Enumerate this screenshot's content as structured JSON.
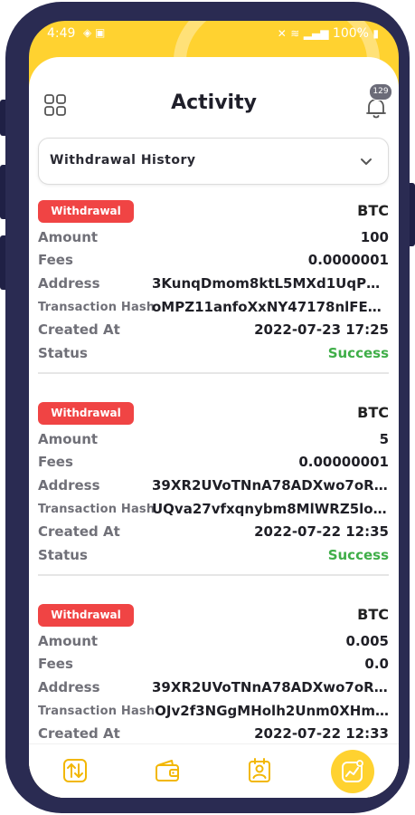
{
  "status_bar": {
    "time": "4:49",
    "battery": "100%"
  },
  "header": {
    "title": "Activity",
    "notification_count": "129"
  },
  "filter": {
    "selected": "Withdrawal History"
  },
  "labels": {
    "amount": "Amount",
    "fees": "Fees",
    "address": "Address",
    "tx_hash": "Transaction Hash",
    "created_at": "Created At",
    "status": "Status"
  },
  "records": [
    {
      "type": "Withdrawal",
      "coin": "BTC",
      "amount": "100",
      "fees": "0.0000001",
      "address": "3KunqDmom8ktL5MXd1UqP1n…",
      "tx_hash": "oMPZ11anfoXxNY47178nlFExOl…",
      "created_at": "2022-07-23 17:25",
      "status": "Success"
    },
    {
      "type": "Withdrawal",
      "coin": "BTC",
      "amount": "5",
      "fees": "0.00000001",
      "address": "39XR2UVoTNnA78ADXwo7oRLf…",
      "tx_hash": "UQva27vfxqnybm8MlWRZ5lo2…",
      "created_at": "2022-07-22 12:35",
      "status": "Success"
    },
    {
      "type": "Withdrawal",
      "coin": "BTC",
      "amount": "0.005",
      "fees": "0.0",
      "address": "39XR2UVoTNnA78ADXwo7oRLf…",
      "tx_hash": "OJv2f3NGgMHolh2Unm0XHm…",
      "created_at": "2022-07-22 12:33"
    }
  ],
  "nav": {
    "items": [
      "transfer-icon",
      "wallet-icon",
      "profile-card-icon",
      "activity-chart-icon"
    ],
    "active_index": 3
  },
  "colors": {
    "accent": "#ffd230",
    "tag": "#f04444",
    "success": "#3fae48"
  }
}
